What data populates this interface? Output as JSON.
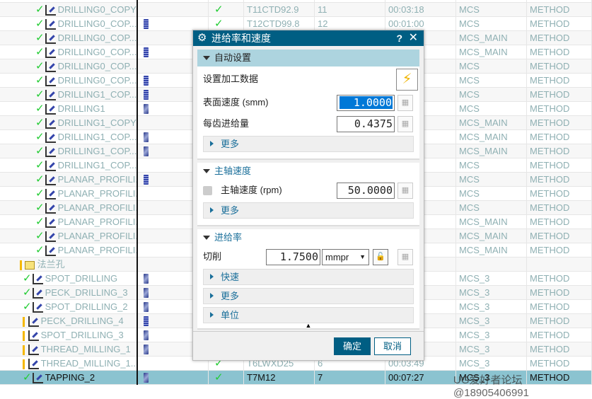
{
  "grid": {
    "rows": [
      {
        "name": "",
        "tool": "",
        "check": true,
        "toolname": "",
        "num": "",
        "time": "",
        "geom": "",
        "method": ""
      },
      {
        "name": "DRILLING0_COPY",
        "tool": "",
        "status": "ok",
        "toolname": "T11CTD92.9",
        "num": "11",
        "time": "00:03:18",
        "geom": "MCS",
        "method": "METHOD"
      },
      {
        "name": "DRILLING0_COP...",
        "tool": "b",
        "status": "ok",
        "toolname": "T12CTD99.8",
        "num": "12",
        "time": "00:01:00",
        "geom": "MCS",
        "method": "METHOD"
      },
      {
        "name": "DRILLING0_COP...",
        "tool": "",
        "status": "ok",
        "geom": "MCS_MAIN",
        "method": "METHOD"
      },
      {
        "name": "DRILLING0_COP...",
        "tool": "b",
        "status": "ok",
        "geom": "MCS_MAIN",
        "method": "METHOD"
      },
      {
        "name": "DRILLING0_COP...",
        "tool": "",
        "status": "ok",
        "geom": "MCS",
        "method": "METHOD"
      },
      {
        "name": "DRILLING0_COP...",
        "tool": "b",
        "status": "ok",
        "geom": "MCS",
        "method": "METHOD"
      },
      {
        "name": "DRILLING1_COP...",
        "tool": "b",
        "status": "ok",
        "geom": "MCS",
        "method": "METHOD"
      },
      {
        "name": "DRILLING1",
        "tool": "d",
        "status": "ok",
        "geom": "MCS",
        "method": "METHOD"
      },
      {
        "name": "DRILLING1_COPY",
        "tool": "",
        "status": "ok",
        "geom": "MCS_MAIN",
        "method": "METHOD"
      },
      {
        "name": "DRILLING1_COP...",
        "tool": "d",
        "status": "ok",
        "geom": "MCS_MAIN",
        "method": "METHOD"
      },
      {
        "name": "DRILLING1_COP...",
        "tool": "d",
        "status": "ok",
        "geom": "MCS_MAIN",
        "method": "METHOD"
      },
      {
        "name": "DRILLING1_COP...",
        "tool": "",
        "status": "ok",
        "geom": "MCS",
        "method": "METHOD"
      },
      {
        "name": "PLANAR_PROFILI...",
        "tool": "b",
        "status": "ok",
        "geom": "MCS",
        "method": "METHOD"
      },
      {
        "name": "PLANAR_PROFILI...",
        "tool": "",
        "status": "ok",
        "geom": "MCS",
        "method": "METHOD"
      },
      {
        "name": "PLANAR_PROFILI...",
        "tool": "",
        "status": "ok",
        "geom": "MCS",
        "method": "METHOD"
      },
      {
        "name": "PLANAR_PROFILI...",
        "tool": "",
        "status": "ok",
        "geom": "MCS_MAIN",
        "method": "METHOD"
      },
      {
        "name": "PLANAR_PROFILI...",
        "tool": "",
        "status": "ok",
        "geom": "MCS_MAIN",
        "method": "METHOD"
      },
      {
        "name": "PLANAR_PROFILI...",
        "tool": "",
        "status": "ok",
        "geom": "MCS_MAIN",
        "method": "METHOD"
      },
      {
        "name": "法兰孔",
        "group": true,
        "status": "warn"
      },
      {
        "name": "SPOT_DRILLING",
        "tool": "d",
        "status": "ok",
        "geom": "MCS_3",
        "method": "METHOD"
      },
      {
        "name": "PECK_DRILLING_3",
        "tool": "d",
        "status": "ok",
        "geom": "MCS_3",
        "method": "METHOD"
      },
      {
        "name": "SPOT_DRILLING_2",
        "tool": "d",
        "status": "ok",
        "geom": "MCS_3",
        "method": "METHOD"
      },
      {
        "name": "PECK_DRILLING_4",
        "tool": "b",
        "status": "warn",
        "geom": "MCS_3",
        "method": "METHOD"
      },
      {
        "name": "SPOT_DRILLING_3",
        "tool": "d",
        "status": "warn",
        "geom": "MCS_3",
        "method": "METHOD"
      },
      {
        "name": "THREAD_MILLING_1",
        "tool": "d",
        "status": "warn",
        "geom": "MCS_3",
        "method": "METHOD"
      },
      {
        "name": "THREAD_MILLING_1...",
        "tool": "",
        "status": "warn",
        "toolname": "T6LWXD25",
        "num": "6",
        "time": "00:03:49",
        "geom": "MCS_3",
        "method": "METHOD"
      },
      {
        "name": "TAPPING_2",
        "tool": "d",
        "status": "ok",
        "check": true,
        "selected": true,
        "toolname": "T7M12",
        "num": "7",
        "time": "00:07:27",
        "geom": "MCS_3",
        "method": "METHOD"
      }
    ]
  },
  "watermark": "UG爱好者论坛@18905406991",
  "dialog": {
    "title": "进给率和速度",
    "help": "?",
    "close": "✕",
    "auto": {
      "header": "自动设置",
      "set_data": "设置加工数据",
      "surface_speed_label": "表面速度 (smm)",
      "surface_speed": "1.0000",
      "feed_per_tooth_label": "每齿进给量",
      "feed_per_tooth": "0.4375",
      "more": "更多"
    },
    "spindle": {
      "header": "主轴速度",
      "label": "主轴速度 (rpm)",
      "value": "50.0000",
      "more": "更多"
    },
    "feed": {
      "header": "进给率",
      "cut_label": "切削",
      "cut_value": "1.7500",
      "unit": "mmpr",
      "rapid": "快速",
      "more": "更多",
      "units": "单位"
    },
    "ok": "确定",
    "cancel": "取消"
  }
}
